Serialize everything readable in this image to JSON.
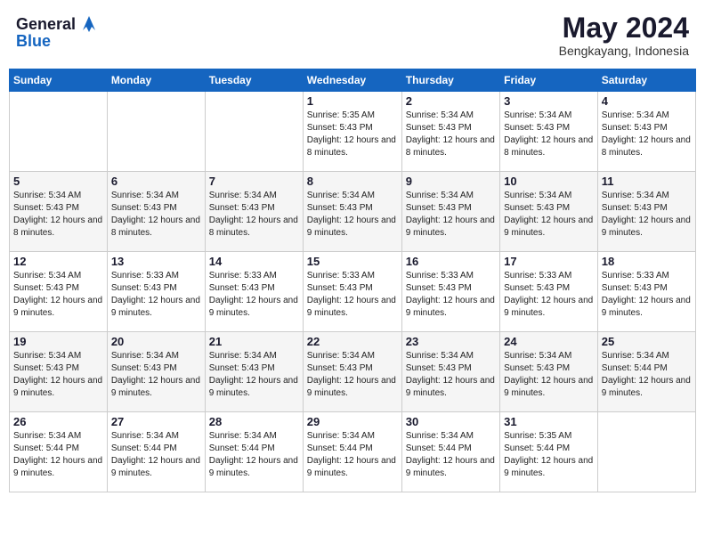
{
  "logo": {
    "text_general": "General",
    "text_blue": "Blue"
  },
  "header": {
    "month": "May 2024",
    "location": "Bengkayang, Indonesia"
  },
  "weekdays": [
    "Sunday",
    "Monday",
    "Tuesday",
    "Wednesday",
    "Thursday",
    "Friday",
    "Saturday"
  ],
  "weeks": [
    [
      {
        "day": "",
        "sunrise": "",
        "sunset": "",
        "daylight": ""
      },
      {
        "day": "",
        "sunrise": "",
        "sunset": "",
        "daylight": ""
      },
      {
        "day": "",
        "sunrise": "",
        "sunset": "",
        "daylight": ""
      },
      {
        "day": "1",
        "sunrise": "Sunrise: 5:35 AM",
        "sunset": "Sunset: 5:43 PM",
        "daylight": "Daylight: 12 hours and 8 minutes."
      },
      {
        "day": "2",
        "sunrise": "Sunrise: 5:34 AM",
        "sunset": "Sunset: 5:43 PM",
        "daylight": "Daylight: 12 hours and 8 minutes."
      },
      {
        "day": "3",
        "sunrise": "Sunrise: 5:34 AM",
        "sunset": "Sunset: 5:43 PM",
        "daylight": "Daylight: 12 hours and 8 minutes."
      },
      {
        "day": "4",
        "sunrise": "Sunrise: 5:34 AM",
        "sunset": "Sunset: 5:43 PM",
        "daylight": "Daylight: 12 hours and 8 minutes."
      }
    ],
    [
      {
        "day": "5",
        "sunrise": "Sunrise: 5:34 AM",
        "sunset": "Sunset: 5:43 PM",
        "daylight": "Daylight: 12 hours and 8 minutes."
      },
      {
        "day": "6",
        "sunrise": "Sunrise: 5:34 AM",
        "sunset": "Sunset: 5:43 PM",
        "daylight": "Daylight: 12 hours and 8 minutes."
      },
      {
        "day": "7",
        "sunrise": "Sunrise: 5:34 AM",
        "sunset": "Sunset: 5:43 PM",
        "daylight": "Daylight: 12 hours and 8 minutes."
      },
      {
        "day": "8",
        "sunrise": "Sunrise: 5:34 AM",
        "sunset": "Sunset: 5:43 PM",
        "daylight": "Daylight: 12 hours and 9 minutes."
      },
      {
        "day": "9",
        "sunrise": "Sunrise: 5:34 AM",
        "sunset": "Sunset: 5:43 PM",
        "daylight": "Daylight: 12 hours and 9 minutes."
      },
      {
        "day": "10",
        "sunrise": "Sunrise: 5:34 AM",
        "sunset": "Sunset: 5:43 PM",
        "daylight": "Daylight: 12 hours and 9 minutes."
      },
      {
        "day": "11",
        "sunrise": "Sunrise: 5:34 AM",
        "sunset": "Sunset: 5:43 PM",
        "daylight": "Daylight: 12 hours and 9 minutes."
      }
    ],
    [
      {
        "day": "12",
        "sunrise": "Sunrise: 5:34 AM",
        "sunset": "Sunset: 5:43 PM",
        "daylight": "Daylight: 12 hours and 9 minutes."
      },
      {
        "day": "13",
        "sunrise": "Sunrise: 5:33 AM",
        "sunset": "Sunset: 5:43 PM",
        "daylight": "Daylight: 12 hours and 9 minutes."
      },
      {
        "day": "14",
        "sunrise": "Sunrise: 5:33 AM",
        "sunset": "Sunset: 5:43 PM",
        "daylight": "Daylight: 12 hours and 9 minutes."
      },
      {
        "day": "15",
        "sunrise": "Sunrise: 5:33 AM",
        "sunset": "Sunset: 5:43 PM",
        "daylight": "Daylight: 12 hours and 9 minutes."
      },
      {
        "day": "16",
        "sunrise": "Sunrise: 5:33 AM",
        "sunset": "Sunset: 5:43 PM",
        "daylight": "Daylight: 12 hours and 9 minutes."
      },
      {
        "day": "17",
        "sunrise": "Sunrise: 5:33 AM",
        "sunset": "Sunset: 5:43 PM",
        "daylight": "Daylight: 12 hours and 9 minutes."
      },
      {
        "day": "18",
        "sunrise": "Sunrise: 5:33 AM",
        "sunset": "Sunset: 5:43 PM",
        "daylight": "Daylight: 12 hours and 9 minutes."
      }
    ],
    [
      {
        "day": "19",
        "sunrise": "Sunrise: 5:34 AM",
        "sunset": "Sunset: 5:43 PM",
        "daylight": "Daylight: 12 hours and 9 minutes."
      },
      {
        "day": "20",
        "sunrise": "Sunrise: 5:34 AM",
        "sunset": "Sunset: 5:43 PM",
        "daylight": "Daylight: 12 hours and 9 minutes."
      },
      {
        "day": "21",
        "sunrise": "Sunrise: 5:34 AM",
        "sunset": "Sunset: 5:43 PM",
        "daylight": "Daylight: 12 hours and 9 minutes."
      },
      {
        "day": "22",
        "sunrise": "Sunrise: 5:34 AM",
        "sunset": "Sunset: 5:43 PM",
        "daylight": "Daylight: 12 hours and 9 minutes."
      },
      {
        "day": "23",
        "sunrise": "Sunrise: 5:34 AM",
        "sunset": "Sunset: 5:43 PM",
        "daylight": "Daylight: 12 hours and 9 minutes."
      },
      {
        "day": "24",
        "sunrise": "Sunrise: 5:34 AM",
        "sunset": "Sunset: 5:43 PM",
        "daylight": "Daylight: 12 hours and 9 minutes."
      },
      {
        "day": "25",
        "sunrise": "Sunrise: 5:34 AM",
        "sunset": "Sunset: 5:44 PM",
        "daylight": "Daylight: 12 hours and 9 minutes."
      }
    ],
    [
      {
        "day": "26",
        "sunrise": "Sunrise: 5:34 AM",
        "sunset": "Sunset: 5:44 PM",
        "daylight": "Daylight: 12 hours and 9 minutes."
      },
      {
        "day": "27",
        "sunrise": "Sunrise: 5:34 AM",
        "sunset": "Sunset: 5:44 PM",
        "daylight": "Daylight: 12 hours and 9 minutes."
      },
      {
        "day": "28",
        "sunrise": "Sunrise: 5:34 AM",
        "sunset": "Sunset: 5:44 PM",
        "daylight": "Daylight: 12 hours and 9 minutes."
      },
      {
        "day": "29",
        "sunrise": "Sunrise: 5:34 AM",
        "sunset": "Sunset: 5:44 PM",
        "daylight": "Daylight: 12 hours and 9 minutes."
      },
      {
        "day": "30",
        "sunrise": "Sunrise: 5:34 AM",
        "sunset": "Sunset: 5:44 PM",
        "daylight": "Daylight: 12 hours and 9 minutes."
      },
      {
        "day": "31",
        "sunrise": "Sunrise: 5:35 AM",
        "sunset": "Sunset: 5:44 PM",
        "daylight": "Daylight: 12 hours and 9 minutes."
      },
      {
        "day": "",
        "sunrise": "",
        "sunset": "",
        "daylight": ""
      }
    ]
  ]
}
